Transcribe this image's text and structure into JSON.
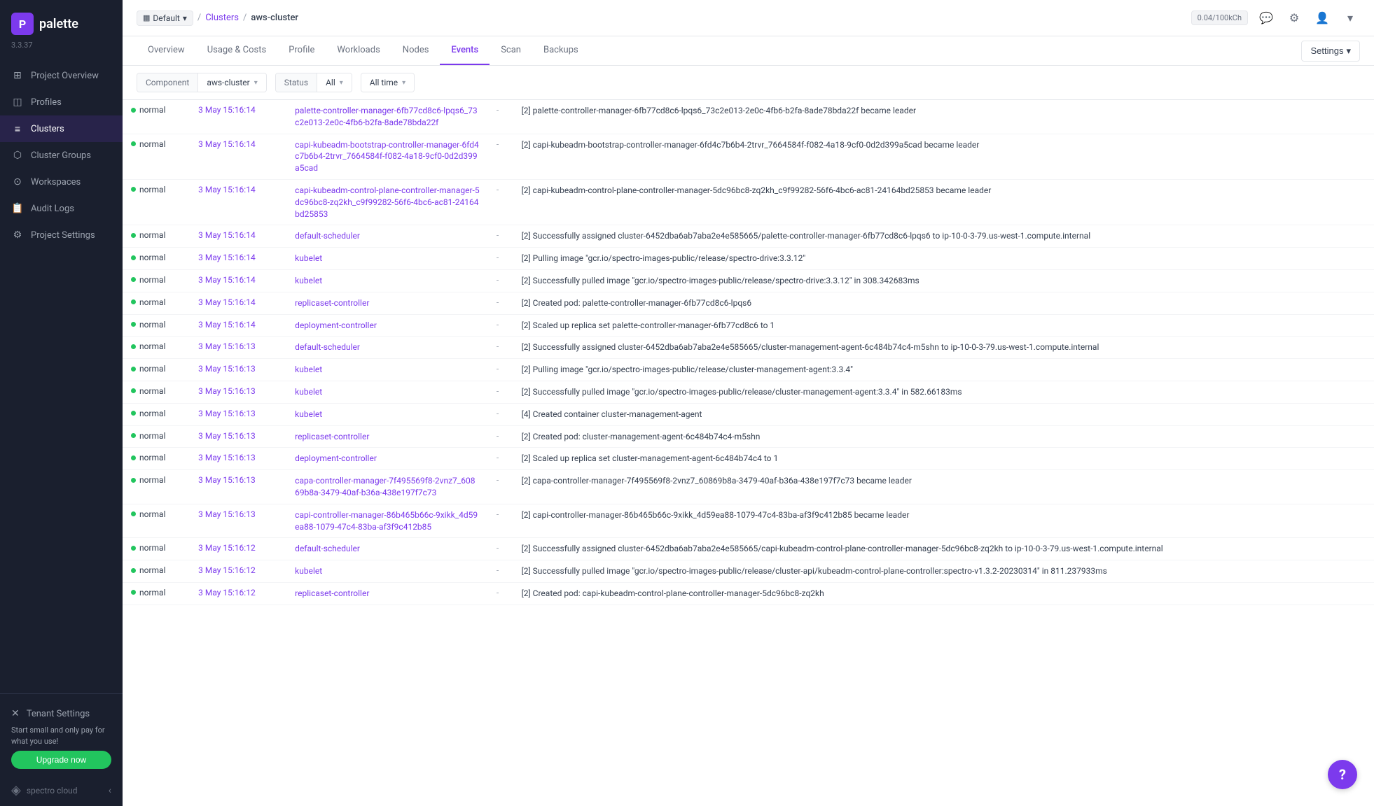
{
  "sidebar": {
    "logo": "palette",
    "version": "3.3.37",
    "logoIconText": "P",
    "items": [
      {
        "id": "project-overview",
        "label": "Project Overview",
        "icon": "⊞"
      },
      {
        "id": "profiles",
        "label": "Profiles",
        "icon": "◫"
      },
      {
        "id": "clusters",
        "label": "Clusters",
        "icon": "≡"
      },
      {
        "id": "cluster-groups",
        "label": "Cluster Groups",
        "icon": "⬡"
      },
      {
        "id": "workspaces",
        "label": "Workspaces",
        "icon": "⊙"
      },
      {
        "id": "audit-logs",
        "label": "Audit Logs",
        "icon": "📋"
      },
      {
        "id": "project-settings",
        "label": "Project Settings",
        "icon": "⚙"
      }
    ],
    "bottom": {
      "tenant_settings": "Tenant Settings",
      "upgrade_text": "Start small and only pay for what you use!",
      "upgrade_btn": "Upgrade now",
      "brand": "spectro cloud",
      "collapse_label": "collapse"
    }
  },
  "topbar": {
    "default_label": "Default",
    "breadcrumb_sep": "/",
    "clusters_link": "Clusters",
    "current_page": "aws-cluster",
    "credit": "0.04/100kCh",
    "settings_label": "Settings"
  },
  "tabs": [
    {
      "id": "overview",
      "label": "Overview"
    },
    {
      "id": "usage-costs",
      "label": "Usage & Costs"
    },
    {
      "id": "profile",
      "label": "Profile"
    },
    {
      "id": "workloads",
      "label": "Workloads"
    },
    {
      "id": "nodes",
      "label": "Nodes"
    },
    {
      "id": "events",
      "label": "Events",
      "active": true
    },
    {
      "id": "scan",
      "label": "Scan"
    },
    {
      "id": "backups",
      "label": "Backups"
    }
  ],
  "filters": {
    "component_label": "Component",
    "component_value": "aws-cluster",
    "status_label": "Status",
    "status_value": "All",
    "time_label": "All time"
  },
  "events": [
    {
      "status": "normal",
      "date": "3 May 15:16:14",
      "component": "palette-controller-manager-6fb77cd8c6-lpqs6_73c2e013-2e0c-4fb6-b2fa-8ade78bda22f",
      "count": "-",
      "message": "[2] palette-controller-manager-6fb77cd8c6-lpqs6_73c2e013-2e0c-4fb6-b2fa-8ade78bda22f became leader"
    },
    {
      "status": "normal",
      "date": "3 May 15:16:14",
      "component": "capi-kubeadm-bootstrap-controller-manager-6fd4c7b6b4-2trvr_7664584f-f082-4a18-9cf0-0d2d399a5cad",
      "count": "-",
      "message": "[2] capi-kubeadm-bootstrap-controller-manager-6fd4c7b6b4-2trvr_7664584f-f082-4a18-9cf0-0d2d399a5cad became leader"
    },
    {
      "status": "normal",
      "date": "3 May 15:16:14",
      "component": "capi-kubeadm-control-plane-controller-manager-5dc96bc8-zq2kh_c9f99282-56f6-4bc6-ac81-24164bd25853",
      "count": "-",
      "message": "[2] capi-kubeadm-control-plane-controller-manager-5dc96bc8-zq2kh_c9f99282-56f6-4bc6-ac81-24164bd25853 became leader"
    },
    {
      "status": "normal",
      "date": "3 May 15:16:14",
      "component": "default-scheduler",
      "count": "-",
      "message": "[2] Successfully assigned cluster-6452dba6ab7aba2e4e585665/palette-controller-manager-6fb77cd8c6-lpqs6 to ip-10-0-3-79.us-west-1.compute.internal"
    },
    {
      "status": "normal",
      "date": "3 May 15:16:14",
      "component": "kubelet",
      "count": "-",
      "message": "[2] Pulling image \"gcr.io/spectro-images-public/release/spectro-drive:3.3.12\""
    },
    {
      "status": "normal",
      "date": "3 May 15:16:14",
      "component": "kubelet",
      "count": "-",
      "message": "[2] Successfully pulled image \"gcr.io/spectro-images-public/release/spectro-drive:3.3.12\" in 308.342683ms"
    },
    {
      "status": "normal",
      "date": "3 May 15:16:14",
      "component": "replicaset-controller",
      "count": "-",
      "message": "[2] Created pod: palette-controller-manager-6fb77cd8c6-lpqs6"
    },
    {
      "status": "normal",
      "date": "3 May 15:16:14",
      "component": "deployment-controller",
      "count": "-",
      "message": "[2] Scaled up replica set palette-controller-manager-6fb77cd8c6 to 1"
    },
    {
      "status": "normal",
      "date": "3 May 15:16:13",
      "component": "default-scheduler",
      "count": "-",
      "message": "[2] Successfully assigned cluster-6452dba6ab7aba2e4e585665/cluster-management-agent-6c484b74c4-m5shn to ip-10-0-3-79.us-west-1.compute.internal"
    },
    {
      "status": "normal",
      "date": "3 May 15:16:13",
      "component": "kubelet",
      "count": "-",
      "message": "[2] Pulling image \"gcr.io/spectro-images-public/release/cluster-management-agent:3.3.4\""
    },
    {
      "status": "normal",
      "date": "3 May 15:16:13",
      "component": "kubelet",
      "count": "-",
      "message": "[2] Successfully pulled image \"gcr.io/spectro-images-public/release/cluster-management-agent:3.3.4\" in 582.66183ms"
    },
    {
      "status": "normal",
      "date": "3 May 15:16:13",
      "component": "kubelet",
      "count": "-",
      "message": "[4] Created container cluster-management-agent"
    },
    {
      "status": "normal",
      "date": "3 May 15:16:13",
      "component": "replicaset-controller",
      "count": "-",
      "message": "[2] Created pod: cluster-management-agent-6c484b74c4-m5shn"
    },
    {
      "status": "normal",
      "date": "3 May 15:16:13",
      "component": "deployment-controller",
      "count": "-",
      "message": "[2] Scaled up replica set cluster-management-agent-6c484b74c4 to 1"
    },
    {
      "status": "normal",
      "date": "3 May 15:16:13",
      "component": "capa-controller-manager-7f495569f8-2vnz7_60869b8a-3479-40af-b36a-438e197f7c73",
      "count": "-",
      "message": "[2] capa-controller-manager-7f495569f8-2vnz7_60869b8a-3479-40af-b36a-438e197f7c73 became leader"
    },
    {
      "status": "normal",
      "date": "3 May 15:16:13",
      "component": "capi-controller-manager-86b465b66c-9xikk_4d59ea88-1079-47c4-83ba-af3f9c412b85",
      "count": "-",
      "message": "[2] capi-controller-manager-86b465b66c-9xikk_4d59ea88-1079-47c4-83ba-af3f9c412b85 became leader"
    },
    {
      "status": "normal",
      "date": "3 May 15:16:12",
      "component": "default-scheduler",
      "count": "-",
      "message": "[2] Successfully assigned cluster-6452dba6ab7aba2e4e585665/capi-kubeadm-control-plane-controller-manager-5dc96bc8-zq2kh to ip-10-0-3-79.us-west-1.compute.internal"
    },
    {
      "status": "normal",
      "date": "3 May 15:16:12",
      "component": "kubelet",
      "count": "-",
      "message": "[2] Successfully pulled image \"gcr.io/spectro-images-public/release/cluster-api/kubeadm-control-plane-controller:spectro-v1.3.2-20230314\" in 811.237933ms"
    },
    {
      "status": "normal",
      "date": "3 May 15:16:12",
      "component": "replicaset-controller",
      "count": "-",
      "message": "[2] Created pod: capi-kubeadm-control-plane-controller-manager-5dc96bc8-zq2kh"
    }
  ],
  "help_btn": "?",
  "colors": {
    "accent": "#7c3aed",
    "green": "#22c55e",
    "sidebar_bg": "#1a1f2e"
  }
}
